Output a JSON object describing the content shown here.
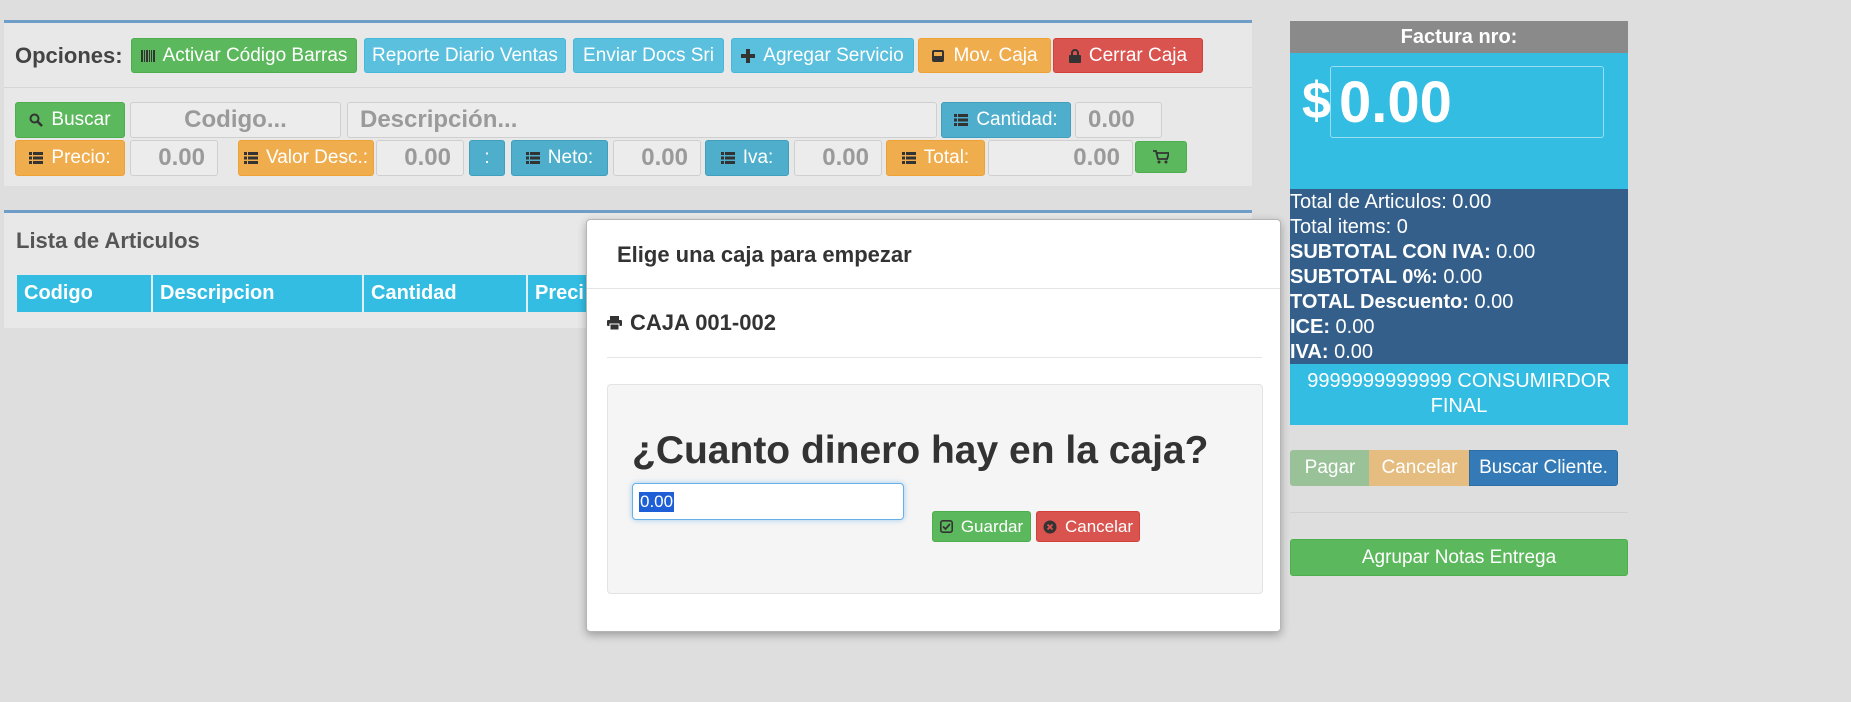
{
  "toolbar": {
    "label": "Opciones:",
    "activar_codigo_barras": "Activar Código Barras",
    "reporte_diario_ventas": "Reporte Diario Ventas",
    "enviar_docs_sri": "Enviar Docs Sri",
    "agregar_servicio": "Agregar Servicio",
    "mov_caja": "Mov. Caja",
    "cerrar_caja": "Cerrar Caja"
  },
  "item_form": {
    "buscar": "Buscar",
    "codigo_placeholder": "Codigo...",
    "descripcion_placeholder": "Descripción...",
    "cantidad_label": "Cantidad:",
    "cantidad_value": "0.00",
    "precio_label": "Precio:",
    "precio_value": "0.00",
    "valor_desc_label": "Valor Desc.:",
    "valor_desc_value": "0.00",
    "colon": ":",
    "neto_label": "Neto:",
    "neto_value": "0.00",
    "iva_label": "Iva:",
    "iva_value": "0.00",
    "total_label": "Total:",
    "total_value": "0.00"
  },
  "list": {
    "title": "Lista de Articulos",
    "columns": [
      "Codigo",
      "Descripcion",
      "Cantidad",
      "Preci"
    ]
  },
  "factura": {
    "header": "Factura nro:",
    "currency": "$",
    "total": "0.00",
    "summary": {
      "total_articulos": "Total de Articulos: 0.00",
      "total_items": "Total items: 0",
      "subtotal_iva_label": "SUBTOTAL CON IVA:",
      "subtotal_iva_value": " 0.00",
      "subtotal_0_label": "SUBTOTAL 0%:",
      "subtotal_0_value": " 0.00",
      "total_descuento_label": "TOTAL Descuento:",
      "total_descuento_value": " 0.00",
      "ice_label": "ICE:",
      "ice_value": " 0.00",
      "iva_label": "IVA:",
      "iva_value": " 0.00"
    },
    "cliente_line1": "9999999999999 CONSUMIRDOR",
    "cliente_line2": "FINAL",
    "pagar": "Pagar",
    "cancelar": "Cancelar",
    "buscar_cliente": "Buscar Cliente.",
    "agrupar_notas": "Agrupar Notas Entrega"
  },
  "modal": {
    "title": "Elige una caja para empezar",
    "caja": "CAJA 001-002",
    "question": "¿Cuanto dinero hay en la caja?",
    "amount": "0.00",
    "guardar": "Guardar",
    "cancelar": "Cancelar"
  },
  "colors": {
    "success": "#5cb85c",
    "info": "#5bc0de",
    "warning": "#f0ad4e",
    "danger": "#d9534f",
    "primary": "#337ab7",
    "accent": "#33bde3"
  }
}
